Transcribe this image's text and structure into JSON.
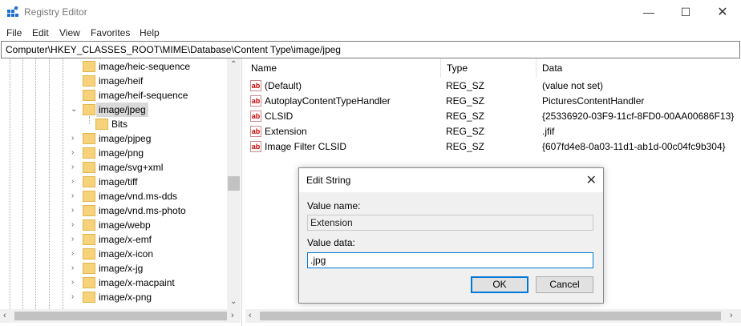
{
  "window": {
    "title": "Registry Editor"
  },
  "menu": [
    "File",
    "Edit",
    "View",
    "Favorites",
    "Help"
  ],
  "address": "Computer\\HKEY_CLASSES_ROOT\\MIME\\Database\\Content Type\\image/jpeg",
  "tree": [
    {
      "label": "image/heic-sequence"
    },
    {
      "label": "image/heif"
    },
    {
      "label": "image/heif-sequence"
    },
    {
      "label": "image/jpeg",
      "selected": true,
      "expanded": true
    },
    {
      "label": "Bits",
      "child": true
    },
    {
      "label": "image/pjpeg"
    },
    {
      "label": "image/png"
    },
    {
      "label": "image/svg+xml"
    },
    {
      "label": "image/tiff"
    },
    {
      "label": "image/vnd.ms-dds"
    },
    {
      "label": "image/vnd.ms-photo"
    },
    {
      "label": "image/webp"
    },
    {
      "label": "image/x-emf"
    },
    {
      "label": "image/x-icon"
    },
    {
      "label": "image/x-jg"
    },
    {
      "label": "image/x-macpaint"
    },
    {
      "label": "image/x-png"
    }
  ],
  "columns": {
    "name": "Name",
    "type": "Type",
    "data": "Data"
  },
  "values": [
    {
      "name": "(Default)",
      "type": "REG_SZ",
      "data": "(value not set)"
    },
    {
      "name": "AutoplayContentTypeHandler",
      "type": "REG_SZ",
      "data": "PicturesContentHandler"
    },
    {
      "name": "CLSID",
      "type": "REG_SZ",
      "data": "{25336920-03F9-11cf-8FD0-00AA00686F13}"
    },
    {
      "name": "Extension",
      "type": "REG_SZ",
      "data": ".jfif"
    },
    {
      "name": "Image Filter CLSID",
      "type": "REG_SZ",
      "data": "{607fd4e8-0a03-11d1-ab1d-00c04fc9b304}"
    }
  ],
  "dialog": {
    "title": "Edit String",
    "value_name_label": "Value name:",
    "value_name": "Extension",
    "value_data_label": "Value data:",
    "value_data": ".jpg",
    "ok": "OK",
    "cancel": "Cancel"
  },
  "icons": {
    "app": "registry-icon",
    "folder": "folder-icon",
    "value": "string-value-icon"
  }
}
